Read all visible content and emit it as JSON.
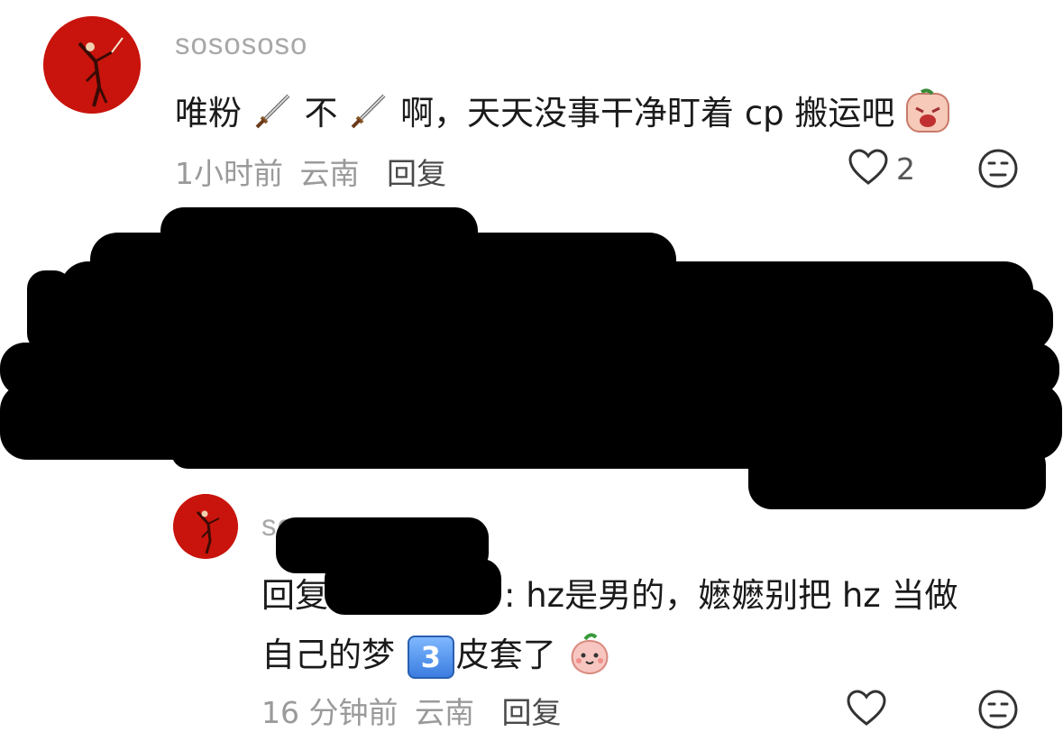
{
  "comment1": {
    "username": "sosososo",
    "text_part1": "唯粉",
    "text_part2": "不",
    "text_part3": "啊，天天没事干净盯着 cp 搬运吧",
    "time": "1小时前",
    "location": "云南",
    "reply_label": "回复",
    "like_count": "2",
    "icons": [
      "dagger-icon",
      "dagger-icon",
      "crying-face-icon",
      "heart-icon",
      "dislike-face-icon"
    ]
  },
  "reply": {
    "username": "sosososo",
    "text_prefix": "回复",
    "text_line1": ": hz是男的，嬷嬷别把 hz 当做",
    "text_line2_part1": "自己的梦",
    "keycap_value": "3",
    "text_line2_part2": "皮套了",
    "time": "16 分钟前",
    "location": "云南",
    "reply_label": "回复",
    "icons": [
      "keycap-3-icon",
      "peach-face-icon",
      "heart-icon",
      "dislike-face-icon"
    ]
  },
  "colors": {
    "avatar_bg": "#c8140c",
    "username": "#a8a8a8",
    "meta": "#9a9a9a",
    "text": "#1a1a1a"
  }
}
